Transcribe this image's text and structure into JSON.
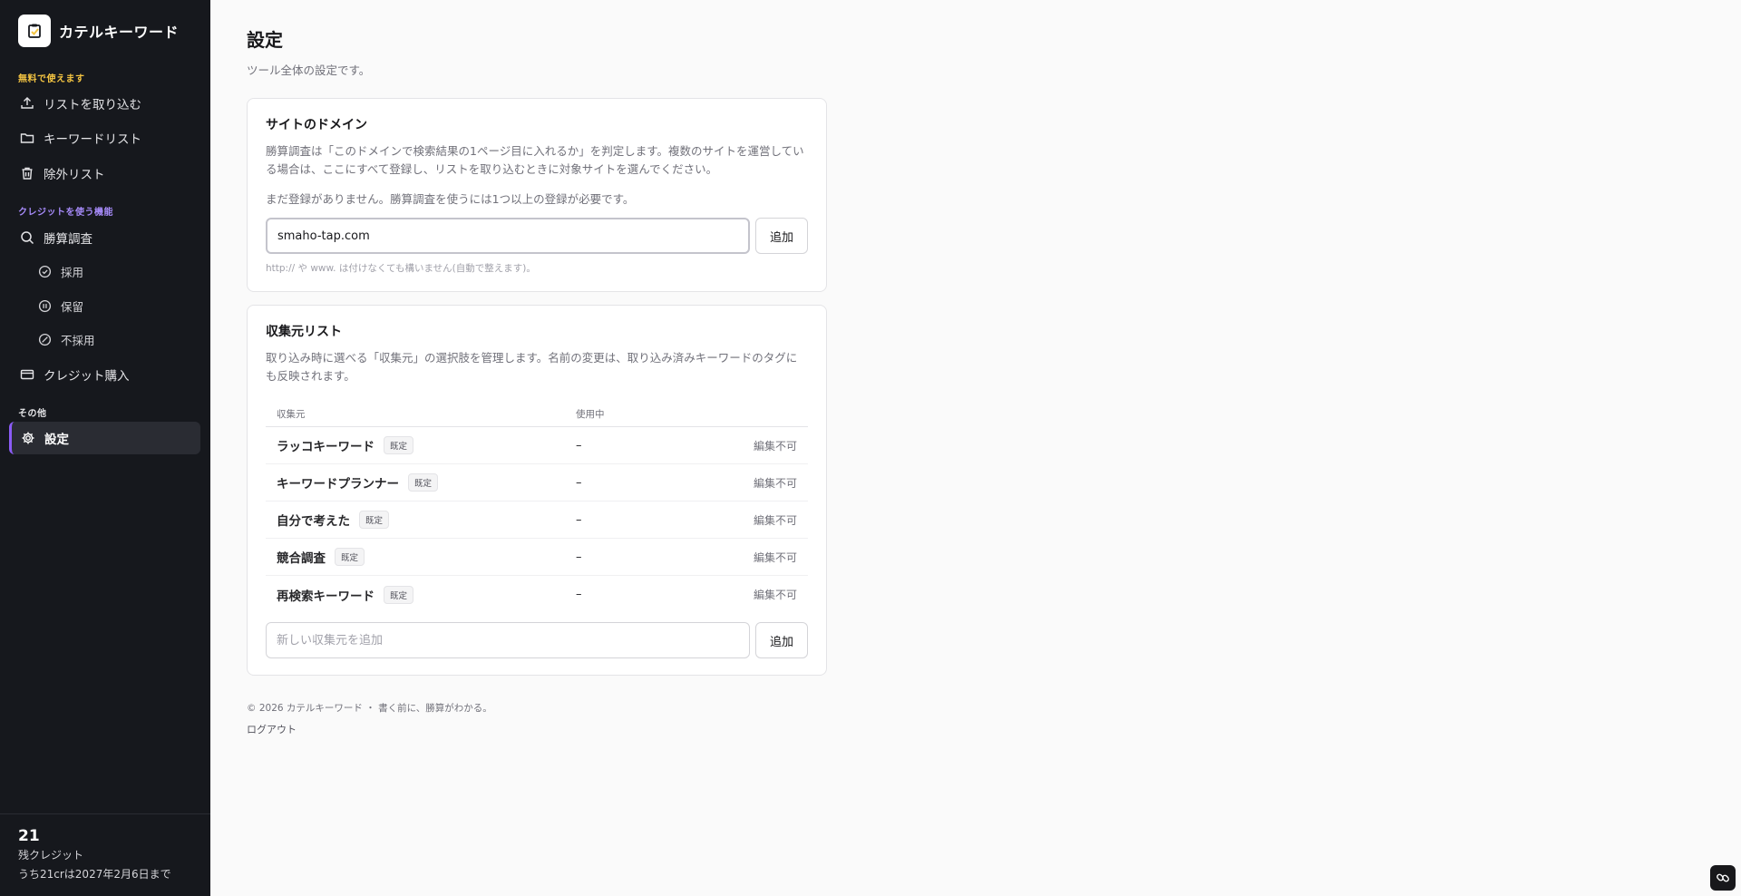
{
  "app": {
    "name": "カテルキーワード"
  },
  "sidebar": {
    "section_free": "無料で使えます",
    "section_credit": "クレジットを使う機能",
    "section_other": "その他",
    "colors": {
      "section_free": "#f5c542",
      "section_credit": "#a78bfa",
      "section_other": "#e4e4e7",
      "active_accent": "#8b5cf6"
    },
    "items": {
      "import": "リストを取り込む",
      "keywords": "キーワードリスト",
      "exclude": "除外リスト",
      "research": "勝算調査",
      "adopt": "採用",
      "hold": "保留",
      "reject": "不採用",
      "buy_credit": "クレジット購入",
      "settings": "設定"
    },
    "credit": {
      "count": "21",
      "label": "残クレジット",
      "detail": "うち21crは2027年2月6日まで"
    }
  },
  "main": {
    "title": "設定",
    "subtitle": "ツール全体の設定です。",
    "domain_card": {
      "title": "サイトのドメイン",
      "description": "勝算調査は「このドメインで検索結果の1ページ目に入れるか」を判定します。複数のサイトを運営している場合は、ここにすべて登録し、リストを取り込むときに対象サイトを選んでください。",
      "empty_note": "まだ登録がありません。勝算調査を使うには1つ以上の登録が必要です。",
      "input_value": "smaho-tap.com",
      "add_label": "追加",
      "hint": "http:// や www. は付けなくても構いません(自動で整えます)。"
    },
    "source_card": {
      "title": "収集元リスト",
      "description": "取り込み時に選べる「収集元」の選択肢を管理します。名前の変更は、取り込み済みキーワードのタグにも反映されます。",
      "col_source": "収集元",
      "col_in_use": "使用中",
      "rows": [
        {
          "name": "ラッコキーワード",
          "badge": "既定",
          "in_use": "–",
          "action": "編集不可"
        },
        {
          "name": "キーワードプランナー",
          "badge": "既定",
          "in_use": "–",
          "action": "編集不可"
        },
        {
          "name": "自分で考えた",
          "badge": "既定",
          "in_use": "–",
          "action": "編集不可"
        },
        {
          "name": "競合調査",
          "badge": "既定",
          "in_use": "–",
          "action": "編集不可"
        },
        {
          "name": "再検索キーワード",
          "badge": "既定",
          "in_use": "–",
          "action": "編集不可"
        }
      ],
      "new_placeholder": "新しい収集元を追加",
      "add_label": "追加"
    },
    "footer": {
      "copyright": "© 2026 カテルキーワード ・ 書く前に、勝算がわかる。",
      "logout": "ログアウト"
    }
  }
}
